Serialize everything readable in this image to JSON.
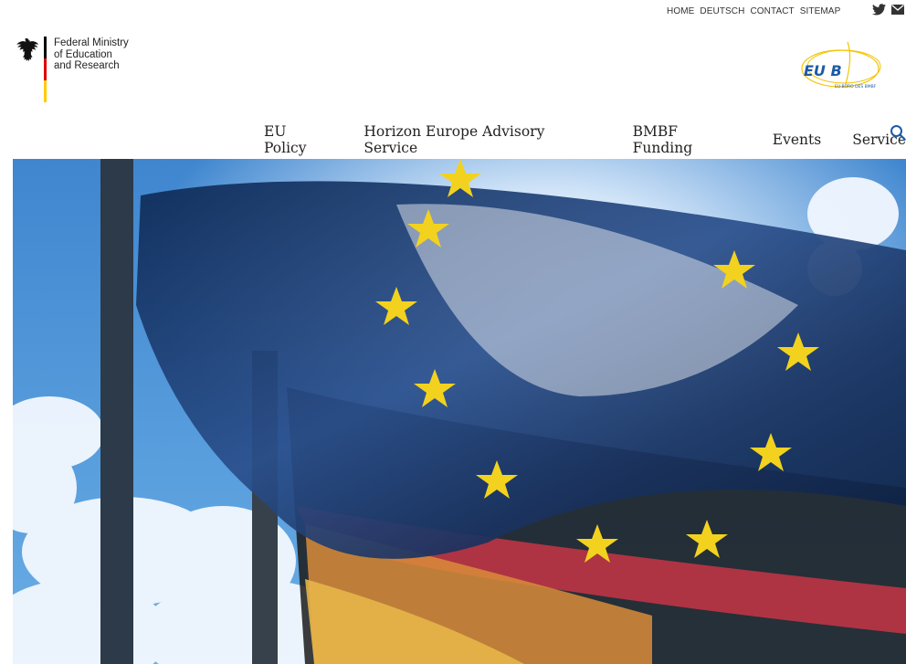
{
  "utility_nav": {
    "items": [
      "HOME",
      "DEUTSCH",
      "CONTACT",
      "SITEMAP"
    ]
  },
  "social": {
    "icons": [
      "twitter-icon",
      "mail-icon"
    ]
  },
  "logo": {
    "ministry_lines": [
      "Federal Ministry",
      "of Education",
      "and Research"
    ],
    "flag_colors": [
      "#000000",
      "#dd0000",
      "#ffcc00"
    ]
  },
  "eub_logo": {
    "text": "EU B",
    "subtext": "EU-BÜRO DES BMBF",
    "color": "#1d5aa6",
    "accent": "#f4c400"
  },
  "main_nav": {
    "items": [
      {
        "label": "EU Policy"
      },
      {
        "label": "Horizon Europe Advisory Service"
      },
      {
        "label": "BMBF Funding"
      },
      {
        "label": "Events"
      },
      {
        "label": "Service"
      }
    ],
    "search_icon": "search-icon"
  },
  "hero": {
    "image": "eu-and-german-flags-waving-against-blue-sky"
  },
  "colors": {
    "text": "#222222",
    "sky": "#4a8fd0",
    "search": "#1d5aa6"
  }
}
